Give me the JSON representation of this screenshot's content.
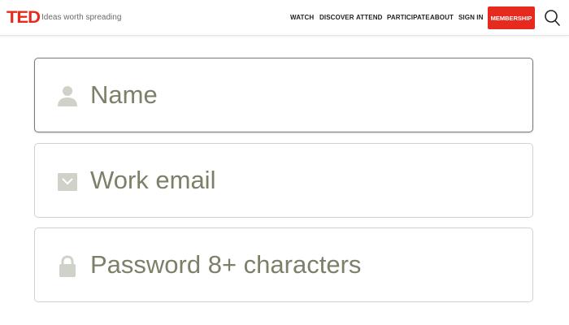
{
  "header": {
    "logo": "TED",
    "tagline": "Ideas worth spreading",
    "nav": [
      "WATCH",
      "DISCOVER",
      "ATTEND",
      "PARTICIPATE",
      "ABOUT",
      "SIGN IN"
    ],
    "membership_label": "MEMBERSHIP",
    "brand_color": "#e62b1e"
  },
  "form": {
    "name_placeholder": "Name",
    "email_placeholder": "Work email",
    "password_placeholder": "Password 8+ characters",
    "icons": [
      "person-icon",
      "envelope-icon",
      "lock-icon"
    ],
    "placeholder_color": "#7d8068"
  }
}
